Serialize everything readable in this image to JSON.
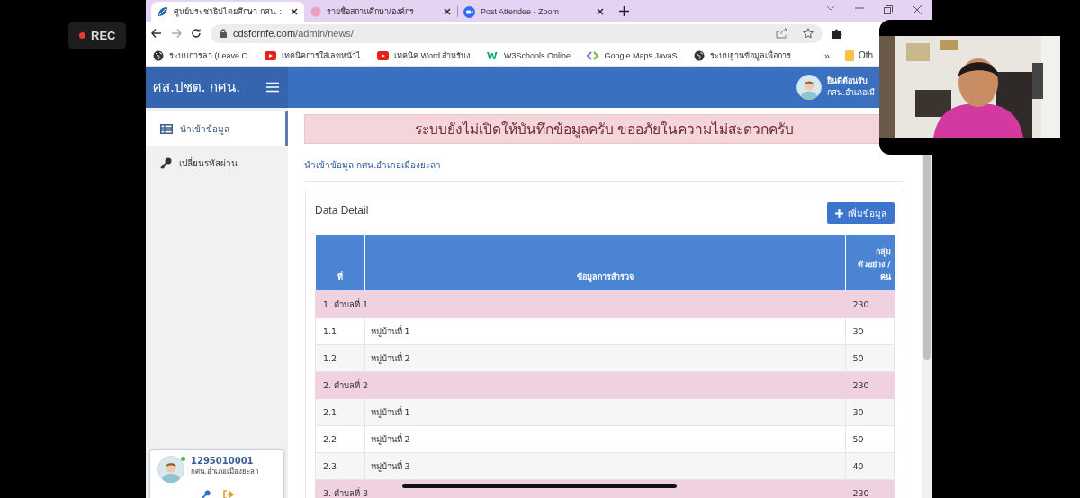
{
  "recording": {
    "label": "REC"
  },
  "browser": {
    "tabs": [
      {
        "title": "ศูนย์ประชาธิปไตยศึกษา กศน. :",
        "selected": true
      },
      {
        "title": "รายชื่อสถานศึกษา/องค์กร",
        "selected": false
      },
      {
        "title": "Post Attendee - Zoom",
        "selected": false
      }
    ],
    "url_host": "cdsfornfe.com",
    "url_path": "/admin/news/",
    "bookmarks": [
      "ระบบการลา (Leave C...",
      "เทคนิคการใส่เลขหน้าไ...",
      "เทคนิค Word สำหรับง...",
      "W3Schools Online...",
      "Google Maps JavaS...",
      "ระบบฐานข้อมูลเพื่อการ..."
    ],
    "bookmarks_more": "»",
    "other_bookmarks": "Oth"
  },
  "app": {
    "brand": "ศส.ปชต. กศน.",
    "user": {
      "greeting": "ยินดีต้อนรับ",
      "unit": "กศน.อำเภอเมื"
    },
    "sidebar": {
      "items": [
        {
          "label": "นำเข้าข้อมูล",
          "selected": true
        },
        {
          "label": "เปลี่ยนรหัสผ่าน",
          "selected": false
        }
      ]
    },
    "profile": {
      "id": "1295010001",
      "unit": "กศน.อำเภอเมืองยะลา",
      "online": true
    },
    "alert": "ระบบยังไม่เปิดให้บันทึกข้อมูลครับ ขออภัยในความไม่สะดวกครับ",
    "breadcrumb": "นำเข้าข้อมูล กศน.อำเภอเมืองยะลา",
    "card": {
      "title": "Data Detail",
      "add_button": "เพิ่มข้อมูล",
      "table": {
        "columns": [
          "ที่",
          "ข้อมูลการสำรวจ",
          "กลุ่มตัวอย่าง / คน"
        ],
        "rows": [
          {
            "kind": "group",
            "label": "1. ตำบลที่ 1",
            "count": "230"
          },
          {
            "kind": "item",
            "no": "1.1",
            "label": "หมู่บ้านที่ 1",
            "count": "30"
          },
          {
            "kind": "item",
            "no": "1.2",
            "label": "หมู่บ้านที่ 2",
            "count": "50"
          },
          {
            "kind": "group",
            "label": "2. ตำบลที่ 2",
            "count": "230"
          },
          {
            "kind": "item",
            "no": "2.1",
            "label": "หมู่บ้านที่ 1",
            "count": "30"
          },
          {
            "kind": "item",
            "no": "2.2",
            "label": "หมู่บ้านที่ 2",
            "count": "50"
          },
          {
            "kind": "item",
            "no": "2.3",
            "label": "หมู่บ้านที่ 3",
            "count": "40"
          },
          {
            "kind": "group",
            "label": "3. ตำบลที่ 3",
            "count": "230"
          }
        ]
      }
    }
  }
}
